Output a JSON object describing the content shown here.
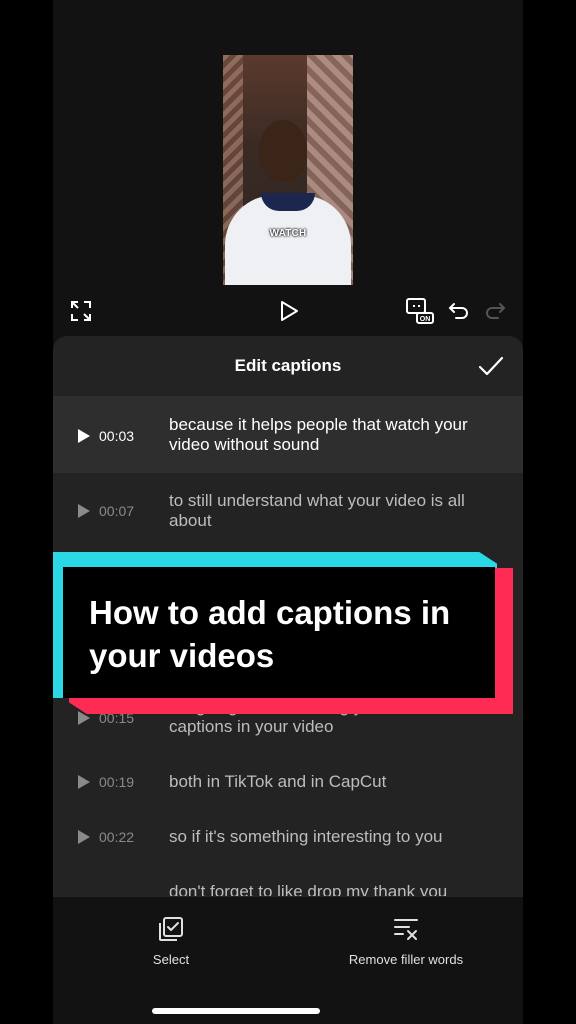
{
  "preview": {
    "caption": "WATCH"
  },
  "panel": {
    "title": "Edit captions",
    "rows": [
      {
        "time": "00:03",
        "text": "because it helps people that watch your video without sound"
      },
      {
        "time": "00:07",
        "text": "to still understand what your video is all about"
      },
      {
        "time": "00:15",
        "text": "I'm going to be teaching you how to add captions in your video"
      },
      {
        "time": "00:19",
        "text": "both in TikTok and in CapCut"
      },
      {
        "time": "00:22",
        "text": "so if it's something interesting to you"
      },
      {
        "time": "",
        "text": "don't forget to like drop my thank you"
      }
    ]
  },
  "toolbar": {
    "select_label": "Select",
    "remove_filler_label": "Remove filler words"
  },
  "overlay": {
    "title": "How to add captions in your videos"
  },
  "colors": {
    "accent_cyan": "#2ad8e6",
    "accent_red": "#fe2c55",
    "panel_bg": "#232323"
  },
  "icons": [
    "fullscreen-icon",
    "play-icon",
    "caption-on-icon",
    "undo-icon",
    "redo-icon",
    "checkmark-icon",
    "select-checkbox-icon",
    "remove-filler-icon"
  ]
}
